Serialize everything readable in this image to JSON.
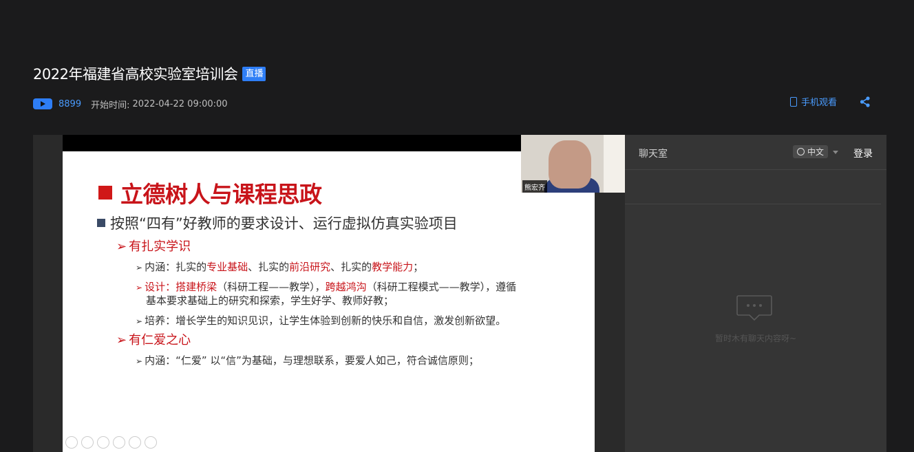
{
  "header": {
    "title": "2022年福建省高校实验室培训会",
    "badge": "直播",
    "views": "8899",
    "start_label": "开始时间:",
    "start_time": "2022-04-22 09:00:00",
    "mobile_label": "手机观看",
    "share_icon": "share-icon"
  },
  "video": {
    "presenter_name": "熊宏齐",
    "slide": {
      "heading": "立德树人与课程思政",
      "line1": "按照“四有”好教师的要求设计、运行虚拟仿真实验项目",
      "sub1": "有扎实学识",
      "b1": {
        "p1": "内涵：扎实的",
        "r1": "专业基础",
        "p2": "、扎实的",
        "r2": "前沿研究",
        "p3": "、扎实的",
        "r3": "教学能力",
        "p4": "；"
      },
      "b2": {
        "r0": "设计：",
        "r1": "搭建桥梁",
        "p1": "（科研工程——教学），",
        "r2": "跨越鸿沟",
        "p2": "（科研工程模式——教学），遵循",
        "line2": "基本要求基础上的研究和探索，学生好学、教师好教；"
      },
      "b3": "培养：增长学生的知识见识，让学生体验到创新的快乐和自信，激发创新欲望。",
      "sub2": "有仁爱之心",
      "b4": "内涵：“仁爱” 以“信”为基础，与理想联系，要爱人如己，符合诚信原则；"
    }
  },
  "chat": {
    "title": "聊天室",
    "lang": "中文",
    "login": "登录",
    "empty_text": "暂时木有聊天内容呀~"
  },
  "colors": {
    "accent": "#2e7ef6",
    "slide_red": "#c8141a"
  }
}
